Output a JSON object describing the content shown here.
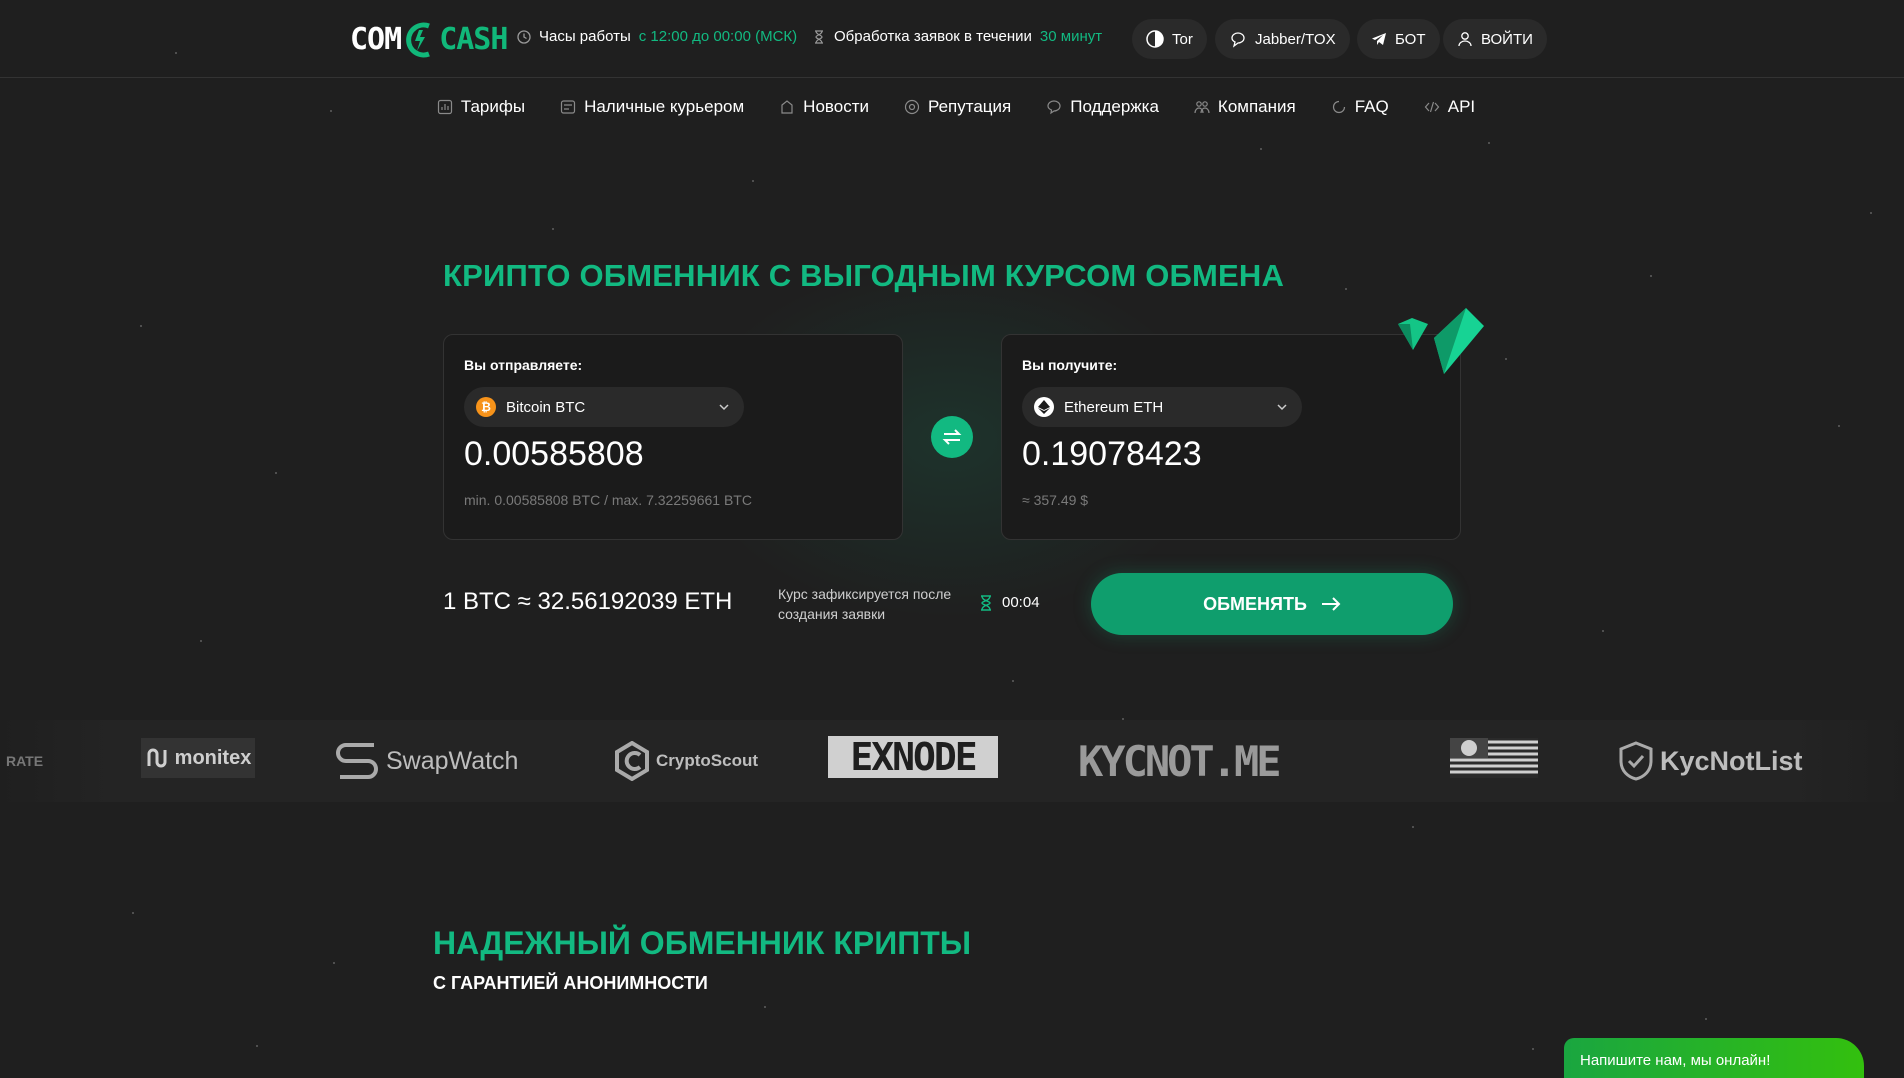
{
  "brand": {
    "logo_left": "COM",
    "logo_right": "CASH"
  },
  "header": {
    "hours_label": "Часы работы",
    "hours_value": "с 12:00 до 00:00 (МСК)",
    "processing_label": "Обработка заявок в течении",
    "processing_value": "30 минут",
    "buttons": {
      "tor": "Tor",
      "jabber": "Jabber/TOX",
      "bot": "БОТ",
      "login": "ВОЙТИ"
    }
  },
  "nav": {
    "items": [
      {
        "label": "Тарифы",
        "icon": "tariff-icon"
      },
      {
        "label": "Наличные курьером",
        "icon": "cash-icon"
      },
      {
        "label": "Новости",
        "icon": "news-icon"
      },
      {
        "label": "Репутация",
        "icon": "reputation-icon"
      },
      {
        "label": "Поддержка",
        "icon": "support-icon"
      },
      {
        "label": "Компания",
        "icon": "company-icon"
      },
      {
        "label": "FAQ",
        "icon": "faq-icon"
      },
      {
        "label": "API",
        "icon": "api-icon"
      }
    ]
  },
  "hero": {
    "title": "КРИПТО ОБМЕННИК С ВЫГОДНЫМ КУРСОМ ОБМЕНА",
    "send": {
      "label": "Вы отправляете:",
      "currency": "Bitcoin BTC",
      "amount": "0.00585808",
      "hint": "min. 0.00585808 BTC / max. 7.32259661 BTC"
    },
    "receive": {
      "label": "Вы получите:",
      "currency": "Ethereum ETH",
      "amount": "0.19078423",
      "hint": "≈ 357.49 $"
    },
    "rate": "1 BTC ≈ 32.56192039 ETH",
    "fix_note": "Курс зафиксируется после создания заявки",
    "timer": "00:04",
    "exchange_button": "ОБМЕНЯТЬ"
  },
  "partners": {
    "items": [
      "RATE",
      "monitex",
      "SwapWatch",
      "CryptoScout",
      "EXNODE",
      "KYCNOT.ME",
      "KycNotList"
    ]
  },
  "section": {
    "title": "НАДЕЖНЫЙ ОБМЕННИК КРИПТЫ",
    "subtitle": "С ГАРАНТИЕЙ АНОНИМНОСТИ"
  },
  "chat": {
    "label": "Напишите нам, мы онлайн!"
  },
  "colors": {
    "accent": "#12b981",
    "background": "#1f1f1f",
    "card": "#1b1b1b"
  }
}
